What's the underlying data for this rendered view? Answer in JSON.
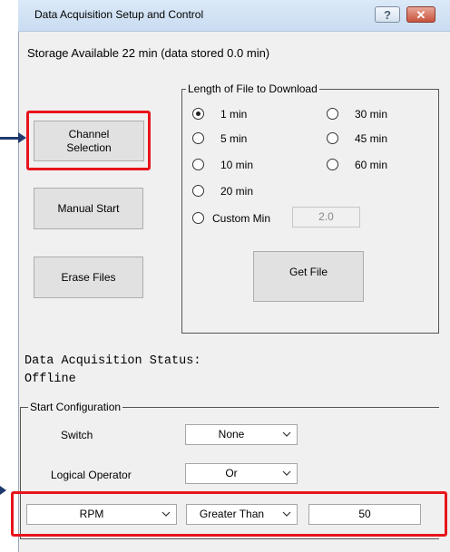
{
  "window": {
    "title": "Data Acquisition Setup and Control",
    "help_glyph": "?",
    "close_glyph": "✕"
  },
  "storage_text": "Storage Available 22 min (data stored 0.0 min)",
  "buttons": {
    "channel_selection": "Channel\nSelection",
    "manual_start": "Manual Start",
    "erase_files": "Erase Files",
    "get_file": "Get File"
  },
  "file_length": {
    "legend": "Length of File to Download",
    "options": [
      "1 min",
      "5 min",
      "10 min",
      "20 min",
      "30 min",
      "45 min",
      "60 min"
    ],
    "selected": "1 min",
    "custom_label": "Custom Min",
    "custom_value": "2.0"
  },
  "status": {
    "heading": "Data Acquisition Status:",
    "value": "Offline"
  },
  "start_config": {
    "legend": "Start Configuration",
    "switch_label": "Switch",
    "switch_value": "None",
    "operator_label": "Logical Operator",
    "operator_value": "Or",
    "channel_value": "RPM",
    "comparison_value": "Greater Than",
    "threshold_value": "50"
  },
  "colors": {
    "highlight": "#e8141b",
    "arrow": "#1f3a6e"
  },
  "icons": {
    "help": "help-icon",
    "close": "close-icon",
    "dropdown": "chevron-down-icon"
  }
}
